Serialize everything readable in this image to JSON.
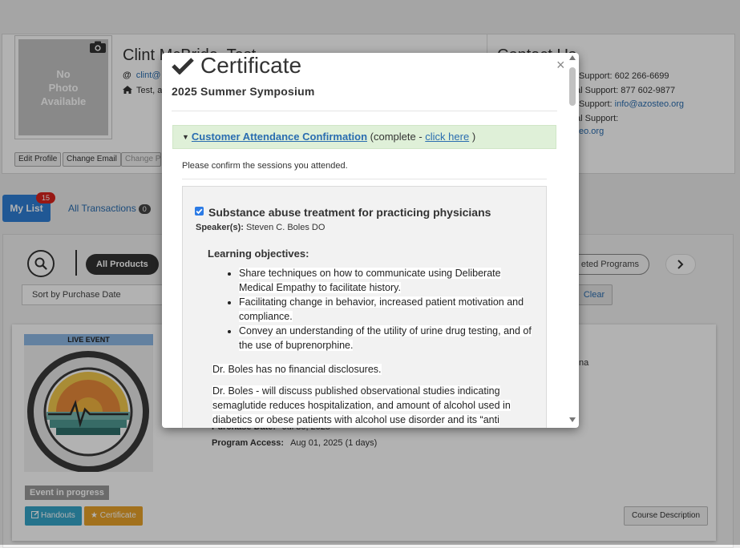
{
  "profile": {
    "photo_text": "No\nPhoto\nAvailable",
    "name": "Clint McBride, Test",
    "email_icon": "@",
    "email": "clint@",
    "address": "Test, a",
    "buttons": [
      "Edit Profile",
      "Change Email",
      "Change Pa"
    ]
  },
  "contact": {
    "title": "Contact Us",
    "lines": [
      {
        "label": "Support: 602 266-6699",
        "link": ""
      },
      {
        "label": "al Support: 877 602-9877",
        "link": ""
      },
      {
        "label": "Support: ",
        "link": "info@azosteo.org"
      },
      {
        "label": "al Support:",
        "link": ""
      },
      {
        "label": "",
        "link": "eo.org"
      }
    ]
  },
  "tabs": {
    "mylist": "My List",
    "mylist_badge": "15",
    "transactions": "All Transactions",
    "transactions_badge": "0"
  },
  "filters": {
    "all_products": "All Products",
    "completed": "eted Programs",
    "sort": "Sort by Purchase Date",
    "clear": "Clear"
  },
  "card": {
    "live_event": "LIVE EVENT",
    "logo_icon": "arizona-osteopathic-medical-association-seal",
    "right_text": "na",
    "purchase_label": "Purchase Date:",
    "purchase_value": "Jul 30, 2025",
    "access_label": "Program Access:",
    "access_value": "Aug 01, 2025 (1 days)",
    "status": "Event in progress",
    "handouts": "Handouts",
    "certificate": "Certificate",
    "course_description": "Course Description"
  },
  "modal": {
    "title": "Certificate",
    "subtitle": "2025 Summer Symposium",
    "close": "×",
    "panel_link": "Customer Attendance Confirmation",
    "panel_mid": "(complete - ",
    "panel_click": "click here",
    "panel_end": ")",
    "confirm_text": "Please confirm the sessions you attended.",
    "session": {
      "checked": true,
      "title": "Substance abuse treatment for practicing physicians",
      "speaker_label": "Speaker(s):",
      "speaker": "Steven C. Boles DO",
      "objectives_label": "Learning objectives:",
      "objectives": [
        "Share techniques on how to communicate using Deliberate Medical Empathy to facilitate history.",
        "Facilitating change in behavior, increased patient motivation and compliance.",
        "Convey an understanding of the utility of urine drug testing, and of the use of buprenorphine."
      ],
      "disclosure": "Dr. Boles has no financial disclosures.",
      "description": "Dr. Boles - will discuss published observational studies indicating semaglutide reduces hospitalization, and amount of alcohol used in diabetics or obese patients with alcohol use disorder and its “anti"
    }
  },
  "colors": {
    "primary": "#2e7fd6",
    "link": "#2a6db0",
    "success_bg": "#dff0d8",
    "warning": "#e8a32a",
    "info": "#36a5c9",
    "danger": "#d9231d"
  }
}
